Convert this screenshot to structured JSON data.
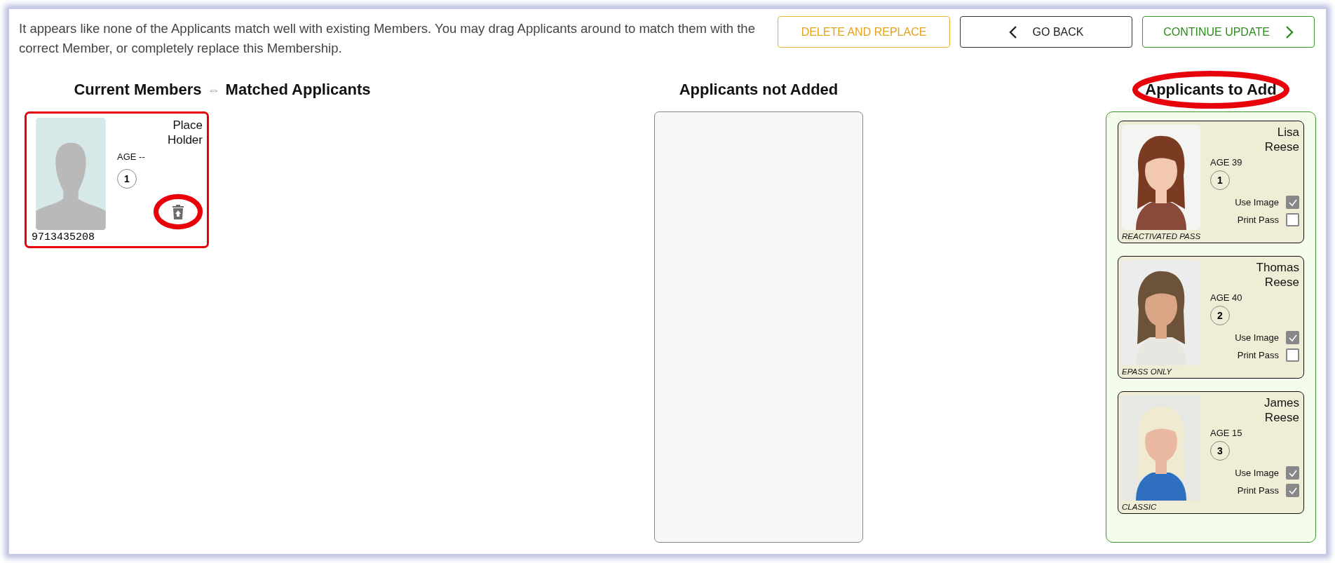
{
  "message": "It appears like none of the Applicants match well with existing Members. You may drag Applicants around to match them with the correct Member, or completely replace this Membership.",
  "buttons": [
    {
      "kind": "delete",
      "label": "DELETE AND REPLACE"
    },
    {
      "kind": "back",
      "label": "GO BACK"
    },
    {
      "kind": "continue",
      "label": "CONTINUE UPDATE"
    }
  ],
  "matched": {
    "title_left": "Current Members",
    "arrow": "⇔",
    "title_right": "Matched Applicants",
    "members": [
      {
        "name_first": "Place",
        "name_last": "Holder",
        "age": "AGE --",
        "number": "1",
        "phone": "9713435208",
        "highlighted": true
      }
    ]
  },
  "not_added": {
    "title": "Applicants not Added"
  },
  "to_add": {
    "title": "Applicants to Add",
    "title_highlighted": true,
    "applicants": [
      {
        "name_first": "Lisa",
        "name_last": "Reese",
        "age": "AGE 39",
        "number": "1",
        "use_image_label": "Use Image",
        "use_image": true,
        "print_pass_label": "Print Pass",
        "print_pass": false,
        "pass_type": "REACTIVATED PASS"
      },
      {
        "name_first": "Thomas",
        "name_last": "Reese",
        "age": "AGE 40",
        "number": "2",
        "use_image_label": "Use Image",
        "use_image": true,
        "print_pass_label": "Print Pass",
        "print_pass": false,
        "pass_type": "EPASS ONLY"
      },
      {
        "name_first": "James",
        "name_last": "Reese",
        "age": "AGE 15",
        "number": "3",
        "use_image_label": "Use Image",
        "use_image": true,
        "print_pass_label": "Print Pass",
        "print_pass": true,
        "pass_type": "CLASSIC"
      }
    ]
  }
}
